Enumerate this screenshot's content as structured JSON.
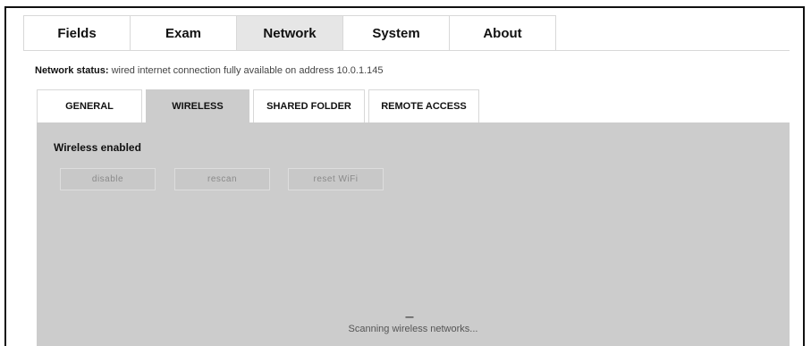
{
  "top_tabs": [
    {
      "label": "Fields"
    },
    {
      "label": "Exam"
    },
    {
      "label": "Network",
      "active": true
    },
    {
      "label": "System"
    },
    {
      "label": "About"
    }
  ],
  "status": {
    "label": "Network status:",
    "text": "wired internet connection fully available on address 10.0.1.145"
  },
  "sub_tabs": [
    {
      "label": "GENERAL"
    },
    {
      "label": "WIRELESS",
      "active": true
    },
    {
      "label": "SHARED FOLDER"
    },
    {
      "label": "REMOTE ACCESS"
    }
  ],
  "wireless": {
    "title": "Wireless enabled",
    "buttons": {
      "disable": "disable",
      "rescan": "rescan",
      "reset": "reset WiFi"
    },
    "spinner": "---",
    "scanning_text": "Scanning wireless networks..."
  },
  "colors": {
    "active_top_tab": "#e6e6e6",
    "panel": "#cccccc"
  }
}
